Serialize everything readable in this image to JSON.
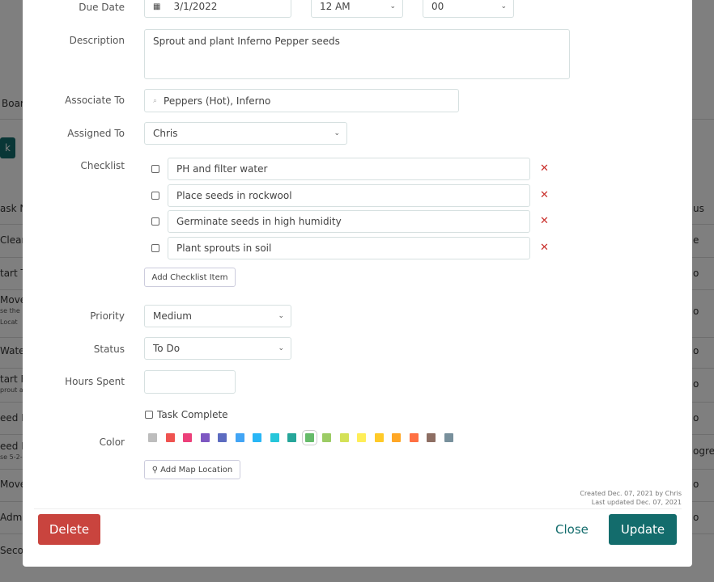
{
  "background": {
    "left_fragments": [
      "Boar",
      "k",
      "ask N",
      "Clean",
      "tart T",
      "Move",
      "se the",
      "Locat",
      "Water",
      "tart F",
      "prout a",
      "eed F",
      "eed F",
      "se 5-2-",
      "Move",
      "Admin",
      "Secon"
    ],
    "right_fragments": [
      "us",
      "e",
      "o",
      "o",
      "o",
      "o",
      "o",
      "ogres",
      "o",
      "o"
    ]
  },
  "form": {
    "due_date_label": "Due Date",
    "due_date": "3/1/2022",
    "hour": "12 AM",
    "minute": "00",
    "description_label": "Description",
    "description": "Sprout and plant Inferno Pepper seeds",
    "associate_label": "Associate To",
    "associate": "Peppers (Hot), Inferno",
    "assigned_label": "Assigned To",
    "assigned": "Chris",
    "checklist_label": "Checklist",
    "checklist": [
      {
        "text": "PH and filter water",
        "checked": false
      },
      {
        "text": "Place seeds in rockwool",
        "checked": false
      },
      {
        "text": "Germinate seeds in high humidity",
        "checked": false
      },
      {
        "text": "Plant sprouts in soil",
        "checked": false
      }
    ],
    "add_checklist_label": "Add Checklist Item",
    "priority_label": "Priority",
    "priority": "Medium",
    "status_label": "Status",
    "status": "To Do",
    "hours_label": "Hours Spent",
    "hours": "",
    "task_complete_label": "Task Complete",
    "color_label": "Color",
    "colors": [
      "#bdbdbd",
      "#ef5350",
      "#ec407a",
      "#7e57c2",
      "#5c6bc0",
      "#42a5f5",
      "#29b6f6",
      "#26c6da",
      "#26a69a",
      "#66bb6a",
      "#9ccc65",
      "#d4e157",
      "#ffee58",
      "#ffca28",
      "#ffa726",
      "#ff7043",
      "#8d6e63",
      "#78909c"
    ],
    "selected_color": "#66bb6a",
    "add_map_label": "Add Map Location",
    "created": "Created Dec. 07, 2021 by Chris",
    "updated": "Last updated Dec. 07, 2021"
  },
  "footer": {
    "delete": "Delete",
    "close": "Close",
    "update": "Update",
    "accent": "#136c6c",
    "danger": "#c9443e"
  }
}
